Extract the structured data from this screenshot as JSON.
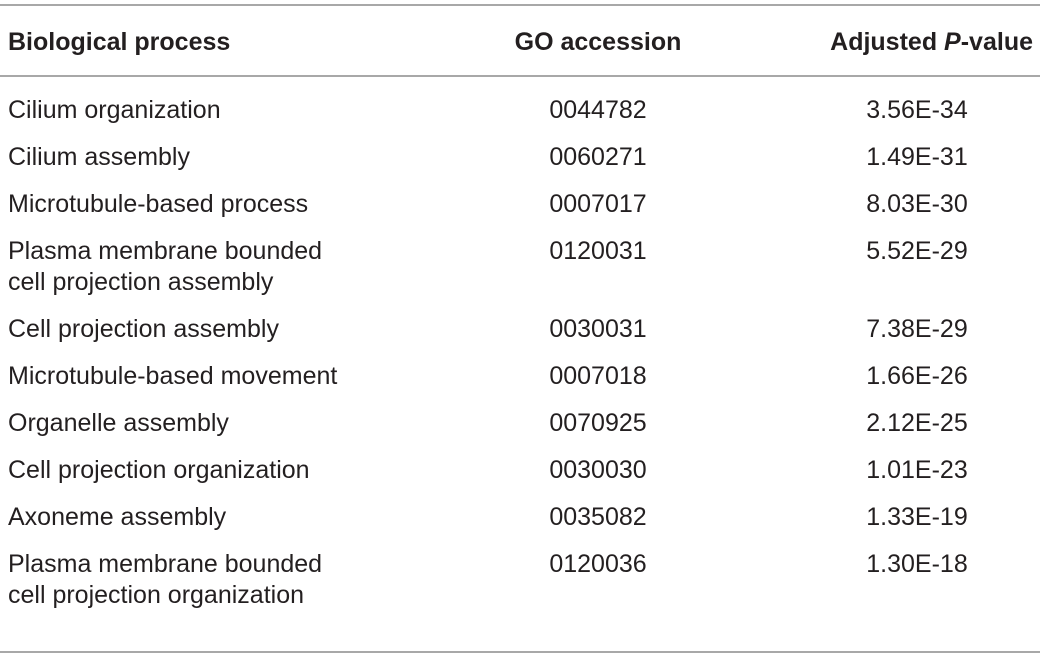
{
  "table": {
    "headers": {
      "process": "Biological process",
      "accession": "GO accession",
      "pvalue_prefix": "Adjusted ",
      "pvalue_italic": "P",
      "pvalue_suffix": "-value"
    },
    "rows": [
      {
        "process": "Cilium organization",
        "accession": "0044782",
        "pvalue": "3.56E-34"
      },
      {
        "process": "Cilium assembly",
        "accession": "0060271",
        "pvalue": "1.49E-31"
      },
      {
        "process": "Microtubule-based process",
        "accession": "0007017",
        "pvalue": "8.03E-30"
      },
      {
        "process": "Plasma membrane bounded\ncell projection assembly",
        "accession": "0120031",
        "pvalue": "5.52E-29"
      },
      {
        "process": "Cell projection assembly",
        "accession": "0030031",
        "pvalue": "7.38E-29"
      },
      {
        "process": "Microtubule-based movement",
        "accession": "0007018",
        "pvalue": "1.66E-26"
      },
      {
        "process": "Organelle assembly",
        "accession": "0070925",
        "pvalue": "2.12E-25"
      },
      {
        "process": "Cell projection organization",
        "accession": "0030030",
        "pvalue": "1.01E-23"
      },
      {
        "process": "Axoneme assembly",
        "accession": "0035082",
        "pvalue": "1.33E-19"
      },
      {
        "process": "Plasma membrane bounded\ncell projection organization",
        "accession": "0120036",
        "pvalue": "1.30E-18"
      }
    ]
  }
}
